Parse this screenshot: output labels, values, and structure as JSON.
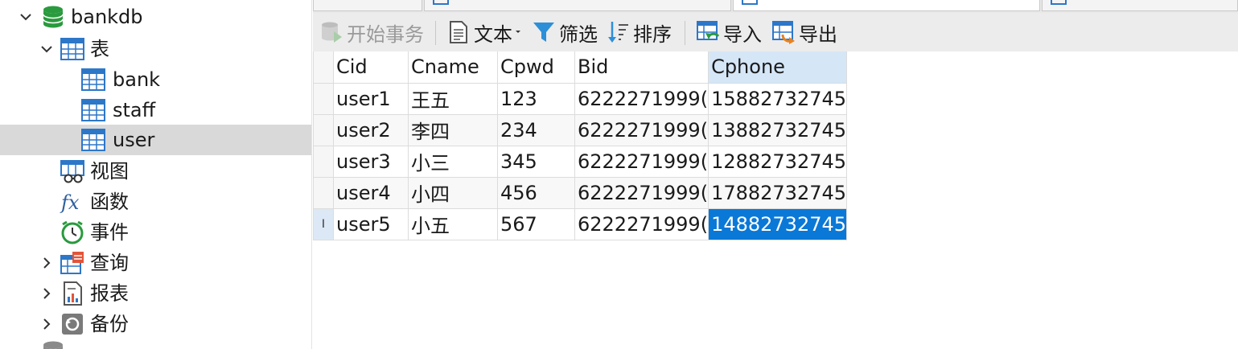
{
  "navigator": {
    "database": "bankdb",
    "tables_folder": "表",
    "tables": [
      "bank",
      "staff",
      "user"
    ],
    "selected_table": "user",
    "views": "视图",
    "functions": "函数",
    "events": "事件",
    "queries": "查询",
    "reports": "报表",
    "backups": "备份"
  },
  "toolbar": {
    "begin_transaction": "开始事务",
    "text": "文本",
    "filter": "筛选",
    "sort": "排序",
    "import": "导入",
    "export": "导出"
  },
  "grid": {
    "columns": [
      "Cid",
      "Cname",
      "Cpwd",
      "Bid",
      "Cphone"
    ],
    "rows": [
      [
        "user1",
        "王五",
        "123",
        "6222271999(",
        "15882732745"
      ],
      [
        "user2",
        "李四",
        "234",
        "6222271999(",
        "13882732745"
      ],
      [
        "user3",
        "小三",
        "345",
        "6222271999(",
        "12882732745"
      ],
      [
        "user4",
        "小四",
        "456",
        "6222271999(",
        "17882732745"
      ],
      [
        "user5",
        "小五",
        "567",
        "6222271999(",
        "14882732745"
      ]
    ],
    "current_row_marker": "I",
    "selected_cell": {
      "row": 5,
      "column": "Cphone"
    }
  },
  "colors": {
    "accent_blue": "#2d77c8",
    "db_green": "#2a9a3e",
    "selected_cell": "#0a78d7",
    "selected_tree_row": "#d9d9d9"
  },
  "icons": {
    "database": "database-icon",
    "table": "table-icon",
    "view": "view-icon",
    "function": "function-icon",
    "event": "clock-icon",
    "query": "query-icon",
    "report": "report-icon",
    "backup": "backup-icon"
  }
}
